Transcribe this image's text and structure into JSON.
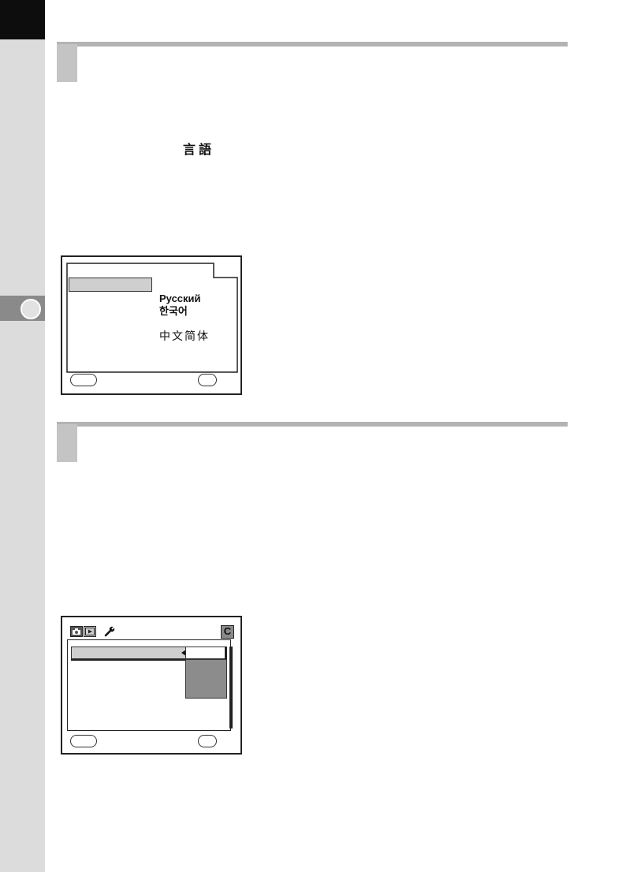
{
  "sidebar": {
    "chapter_tab_icon": "chapter-circle"
  },
  "section1": {
    "inline_japanese": "言語"
  },
  "language_screen": {
    "languages": {
      "russian": "Русский",
      "korean": "한국어",
      "chinese_simplified": "中文简体"
    },
    "icons": {
      "left_button": "menu-pill",
      "right_button": "ok-pill"
    }
  },
  "setup_screen": {
    "tab_icons": [
      "camera-icon",
      "playback-icon",
      "wrench-icon"
    ],
    "custom_tab_label": "C",
    "icons": {
      "selector_arrow": "left-triangle",
      "left_button": "menu-pill",
      "right_button": "ok-pill"
    }
  },
  "colors": {
    "corner_block": "#0d0d0d",
    "side_strip": "#dcdcdc",
    "section_bar": "#b3b3b3",
    "highlight": "#cfcfcf",
    "dropdown": "#8c8c8c"
  }
}
